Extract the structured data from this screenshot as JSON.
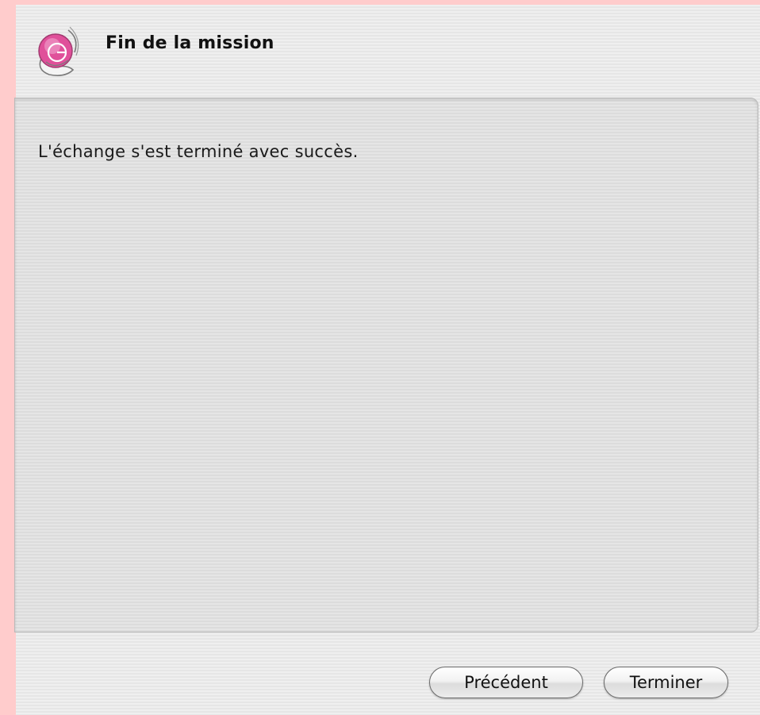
{
  "header": {
    "title": "Fin de la mission",
    "icon": "assistant-globe-icon"
  },
  "content": {
    "message": "L'échange s'est terminé avec succès."
  },
  "buttons": {
    "previous_label": "Précédent",
    "finish_label": "Terminer"
  },
  "colors": {
    "background_frame": "#ffcccc",
    "window_background": "#ececec",
    "panel_background": "#e2e2e2",
    "icon_accent": "#e0509a"
  }
}
